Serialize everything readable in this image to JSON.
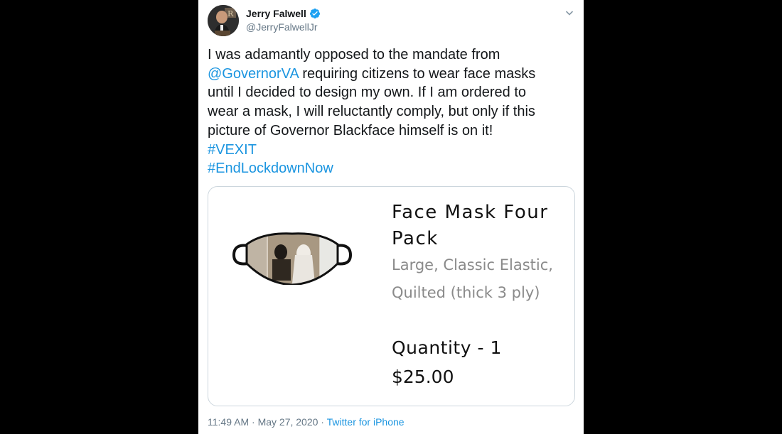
{
  "author": {
    "name": "Jerry Falwell",
    "handle": "@JerryFalwellJr",
    "verified_icon": "verified-badge-icon"
  },
  "tweet": {
    "line1": "I was adamantly opposed to the mandate from",
    "mention": "@GovernorVA",
    "line2_rest": " requiring citizens to wear face masks",
    "line3": "until I decided to design my own. If I am ordered to",
    "line4": "wear a mask, I will reluctantly comply, but only if this",
    "line5": "picture of Governor Blackface himself is on it!",
    "hashtag1": "#VEXIT",
    "hashtag2": "#EndLockdownNow"
  },
  "card": {
    "title_line1": "Face Mask Four",
    "title_line2": "Pack",
    "subtitle_line1": "Large, Classic Elastic,",
    "subtitle_line2": "Quilted (thick 3 ply)",
    "quantity": "Quantity - 1",
    "price": "$25.00"
  },
  "meta": {
    "time": "11:49 AM",
    "separator1": " · ",
    "date": "May 27, 2020",
    "separator2": " · ",
    "source": "Twitter for iPhone"
  },
  "colors": {
    "link": "#1b95e0",
    "muted": "#657786",
    "background": "#000000"
  }
}
